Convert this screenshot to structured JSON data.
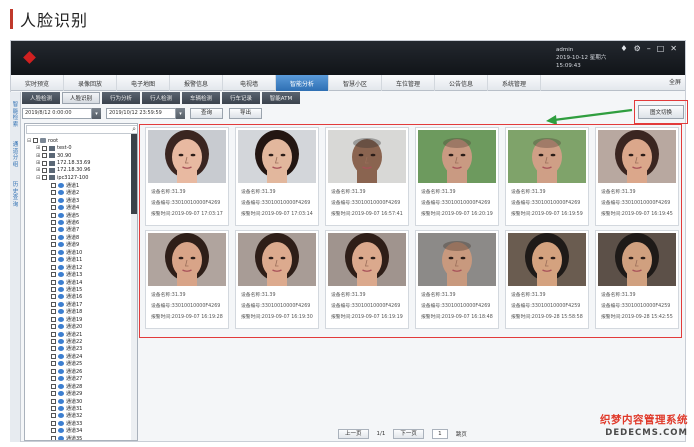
{
  "article": {
    "title": "人脸识别"
  },
  "app": {
    "user": {
      "name": "admin",
      "date": "2019-10-12",
      "weekday": "星期六",
      "time": "15:09:43"
    },
    "header_icons": [
      "bell-icon",
      "settings-icon",
      "minimize-icon",
      "maximize-icon",
      "close-icon"
    ],
    "nav": {
      "items": [
        "实时预览",
        "录像回放",
        "电子地图",
        "报警信息",
        "电视墙",
        "智能分析",
        "智慧小区",
        "车位管理",
        "公告信息",
        "系统管理"
      ],
      "active_index": 5,
      "all_label": "全屏"
    },
    "subnav": {
      "items": [
        "人脸检测",
        "人脸识别",
        "行为分析",
        "行人检测",
        "车辆检测",
        "行车记录",
        "智能ATM"
      ],
      "active_index": 1
    },
    "side_tabs": [
      "智能检索",
      "通道分组",
      "历史查询"
    ],
    "filter": {
      "start": "2019/8/12 0:00:00",
      "end": "2019/10/12 23:59:59",
      "query_label": "查询",
      "export_label": "导出",
      "switch_label": "图文切换"
    },
    "tree": {
      "rows": [
        {
          "indent": 0,
          "exp": "⊟",
          "check": true,
          "icon": "server",
          "label": "root"
        },
        {
          "indent": 1,
          "exp": "⊞",
          "check": true,
          "icon": "dvr",
          "label": "test-0"
        },
        {
          "indent": 1,
          "exp": "⊞",
          "check": true,
          "icon": "dvr",
          "label": "30.90"
        },
        {
          "indent": 1,
          "exp": "⊞",
          "check": true,
          "icon": "dvr",
          "label": "172.18.33.69"
        },
        {
          "indent": 1,
          "exp": "⊞",
          "check": true,
          "icon": "dvr",
          "label": "172.18.30.96"
        },
        {
          "indent": 1,
          "exp": "⊟",
          "check": true,
          "icon": "dvr",
          "label": "ipc3127-100"
        },
        {
          "indent": 2,
          "exp": "",
          "check": true,
          "icon": "cam",
          "label": "通道1"
        },
        {
          "indent": 2,
          "exp": "",
          "check": true,
          "icon": "cam",
          "label": "通道2"
        },
        {
          "indent": 2,
          "exp": "",
          "check": true,
          "icon": "cam",
          "label": "通道3"
        },
        {
          "indent": 2,
          "exp": "",
          "check": true,
          "icon": "cam",
          "label": "通道4"
        },
        {
          "indent": 2,
          "exp": "",
          "check": true,
          "icon": "cam",
          "label": "通道5"
        },
        {
          "indent": 2,
          "exp": "",
          "check": true,
          "icon": "cam",
          "label": "通道6"
        },
        {
          "indent": 2,
          "exp": "",
          "check": true,
          "icon": "cam",
          "label": "通道7"
        },
        {
          "indent": 2,
          "exp": "",
          "check": true,
          "icon": "cam",
          "label": "通道8"
        },
        {
          "indent": 2,
          "exp": "",
          "check": true,
          "icon": "cam",
          "label": "通道9"
        },
        {
          "indent": 2,
          "exp": "",
          "check": true,
          "icon": "cam",
          "label": "通道10"
        },
        {
          "indent": 2,
          "exp": "",
          "check": true,
          "icon": "cam",
          "label": "通道11"
        },
        {
          "indent": 2,
          "exp": "",
          "check": true,
          "icon": "cam",
          "label": "通道12"
        },
        {
          "indent": 2,
          "exp": "",
          "check": true,
          "icon": "cam",
          "label": "通道13"
        },
        {
          "indent": 2,
          "exp": "",
          "check": true,
          "icon": "cam",
          "label": "通道14"
        },
        {
          "indent": 2,
          "exp": "",
          "check": true,
          "icon": "cam",
          "label": "通道15"
        },
        {
          "indent": 2,
          "exp": "",
          "check": true,
          "icon": "cam",
          "label": "通道16"
        },
        {
          "indent": 2,
          "exp": "",
          "check": true,
          "icon": "cam",
          "label": "通道17"
        },
        {
          "indent": 2,
          "exp": "",
          "check": true,
          "icon": "cam",
          "label": "通道18"
        },
        {
          "indent": 2,
          "exp": "",
          "check": true,
          "icon": "cam",
          "label": "通道19"
        },
        {
          "indent": 2,
          "exp": "",
          "check": true,
          "icon": "cam",
          "label": "通道20"
        },
        {
          "indent": 2,
          "exp": "",
          "check": true,
          "icon": "cam",
          "label": "通道21"
        },
        {
          "indent": 2,
          "exp": "",
          "check": true,
          "icon": "cam",
          "label": "通道22"
        },
        {
          "indent": 2,
          "exp": "",
          "check": true,
          "icon": "cam",
          "label": "通道23"
        },
        {
          "indent": 2,
          "exp": "",
          "check": true,
          "icon": "cam",
          "label": "通道24"
        },
        {
          "indent": 2,
          "exp": "",
          "check": true,
          "icon": "cam",
          "label": "通道25"
        },
        {
          "indent": 2,
          "exp": "",
          "check": true,
          "icon": "cam",
          "label": "通道26"
        },
        {
          "indent": 2,
          "exp": "",
          "check": true,
          "icon": "cam",
          "label": "通道27"
        },
        {
          "indent": 2,
          "exp": "",
          "check": true,
          "icon": "cam",
          "label": "通道28"
        },
        {
          "indent": 2,
          "exp": "",
          "check": true,
          "icon": "cam",
          "label": "通道29"
        },
        {
          "indent": 2,
          "exp": "",
          "check": true,
          "icon": "cam",
          "label": "通道30"
        },
        {
          "indent": 2,
          "exp": "",
          "check": true,
          "icon": "cam",
          "label": "通道31"
        },
        {
          "indent": 2,
          "exp": "",
          "check": true,
          "icon": "cam",
          "label": "通道32"
        },
        {
          "indent": 2,
          "exp": "",
          "check": true,
          "icon": "cam",
          "label": "通道33"
        },
        {
          "indent": 2,
          "exp": "",
          "check": true,
          "icon": "cam",
          "label": "通道34"
        },
        {
          "indent": 2,
          "exp": "",
          "check": true,
          "icon": "cam",
          "label": "通道35"
        }
      ]
    },
    "cards": [
      {
        "device_name": "设备名称:31.39",
        "device_id": "设备编号:33010010000F4269",
        "alarm_time": "报警时间:2019-09-07 17:03:17",
        "face": {
          "skin": "#e8b9a1",
          "hair": "#3a2520",
          "bg": "#c8cbd0",
          "bald": false
        }
      },
      {
        "device_name": "设备名称:31.39",
        "device_id": "设备编号:33010010000F4269",
        "alarm_time": "报警时间:2019-09-07 17:03:14",
        "face": {
          "skin": "#e2b79d",
          "hair": "#231612",
          "bg": "#d3d6da",
          "bald": false
        }
      },
      {
        "device_name": "设备名称:31.39",
        "device_id": "设备编号:33010010000F4269",
        "alarm_time": "报警时间:2019-09-07 16:57:41",
        "face": {
          "skin": "#8a6450",
          "hair": "#2a2a2a",
          "bg": "#d8d8d6",
          "bald": true
        }
      },
      {
        "device_name": "设备名称:31.39",
        "device_id": "设备编号:33010010000F4269",
        "alarm_time": "报警时间:2019-09-07 16:20:19",
        "face": {
          "skin": "#c99a82",
          "hair": "#4a3a30",
          "bg": "#6d9a5e",
          "bald": true
        }
      },
      {
        "device_name": "设备名称:31.39",
        "device_id": "设备编号:33010010000F4269",
        "alarm_time": "报警时间:2019-09-07 16:19:59",
        "face": {
          "skin": "#cf9f86",
          "hair": "#4a3a30",
          "bg": "#7fa36a",
          "bald": true
        }
      },
      {
        "device_name": "设备名称:31.39",
        "device_id": "设备编号:33010010000F4269",
        "alarm_time": "报警时间:2019-09-07 16:19:45",
        "face": {
          "skin": "#dba78b",
          "hair": "#3a2520",
          "bg": "#b8a8a0",
          "bald": false
        }
      },
      {
        "device_name": "设备名称:31.39",
        "device_id": "设备编号:33010010000F4269",
        "alarm_time": "报警时间:2019-09-07 16:19:28",
        "face": {
          "skin": "#d8a488",
          "hair": "#2e1e18",
          "bg": "#b0a49e",
          "bald": false
        }
      },
      {
        "device_name": "设备名称:31.39",
        "device_id": "设备编号:33010010000F4269",
        "alarm_time": "报警时间:2019-09-07 16:19:30",
        "face": {
          "skin": "#dcaa8e",
          "hair": "#2e1e18",
          "bg": "#a89c96",
          "bald": false
        }
      },
      {
        "device_name": "设备名称:31.39",
        "device_id": "设备编号:33010010000F4269",
        "alarm_time": "报警时间:2019-09-07 16:19:19",
        "face": {
          "skin": "#dba98d",
          "hair": "#2e1e18",
          "bg": "#a0948e",
          "bald": false
        }
      },
      {
        "device_name": "设备名称:31.39",
        "device_id": "设备编号:33010010000F4269",
        "alarm_time": "报警时间:2019-09-07 16:18:48",
        "face": {
          "skin": "#c8997e",
          "hair": "#3a2a22",
          "bg": "#8c8a88",
          "bald": true
        }
      },
      {
        "device_name": "设备名称:31.39",
        "device_id": "设备编号:33010010000F4259",
        "alarm_time": "报警时间:2019-09-28 15:58:58",
        "face": {
          "skin": "#d4a27f",
          "hair": "#1e1a18",
          "bg": "#6a5c50",
          "bald": false
        }
      },
      {
        "device_name": "设备名称:31.39",
        "device_id": "设备编号:33010010000F4259",
        "alarm_time": "报警时间:2019-09-28 15:42:55",
        "face": {
          "skin": "#d0a07f",
          "hair": "#1e1a18",
          "bg": "#5c5048",
          "bald": false
        }
      }
    ],
    "pager": {
      "prev_label": "上一页",
      "page_info": "1/1",
      "next_label": "下一页",
      "page_value": "1",
      "go_label": "跳页"
    }
  },
  "watermark": {
    "line1": "织梦内容管理系统",
    "line2": "DEDECMS.COM"
  },
  "colors": {
    "accent": "#2e6fb3",
    "highlight_red": "#e23b3b",
    "arrow_green": "#2f9e3f",
    "header_dark": "#111418"
  }
}
